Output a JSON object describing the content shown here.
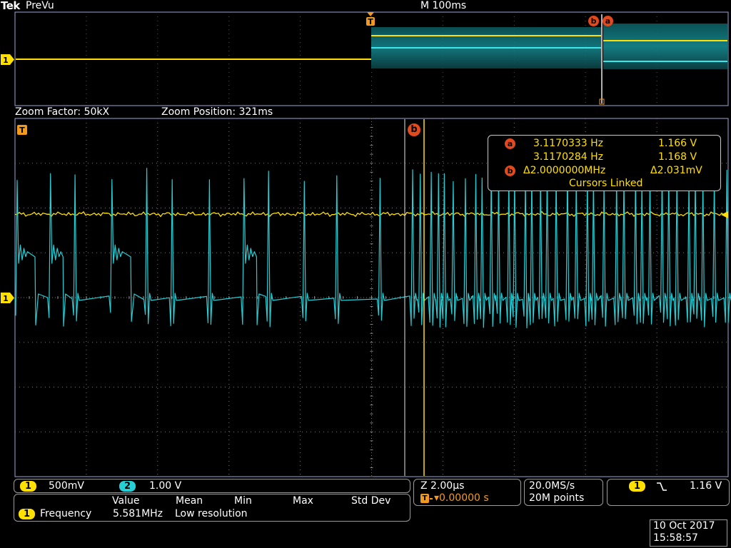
{
  "header": {
    "brand": "Tek",
    "mode": "PreVu",
    "timebase": "M 100ms"
  },
  "zoom": {
    "factor": "Zoom Factor: 50kX",
    "position": "Zoom Position: 321ms"
  },
  "markers": {
    "trigger": "T",
    "cursor_a": "a",
    "cursor_b": "b",
    "ch1": "1"
  },
  "cursor_readout": {
    "a_freq": "3.1170333 Hz",
    "a_volt": "1.166 V",
    "b_freq": "3.1170284 Hz",
    "b_volt": "1.168 V",
    "delta_freq": "Δ2.0000000MHz",
    "delta_volt": "Δ2.031mV",
    "linked": "Cursors Linked"
  },
  "channels": [
    {
      "id": "1",
      "scale": "500mV",
      "color": "#ffe000"
    },
    {
      "id": "2",
      "scale": "1.00 V",
      "color": "#25cfd6"
    }
  ],
  "measurements": {
    "headers": [
      "Value",
      "Mean",
      "Min",
      "Max",
      "Std Dev"
    ],
    "rows": [
      {
        "channel": "1",
        "name": "Frequency",
        "value": "5.581MHz",
        "note": "Low resolution"
      }
    ]
  },
  "horizontal": {
    "zoom_scale": "Z 2.00μs",
    "trigger_pos": "▾0.00000 s"
  },
  "acquisition": {
    "rate": "20.0MS/s",
    "points": "20M points"
  },
  "trigger": {
    "channel": "1",
    "slope_icon": "falling-edge-icon",
    "level": "1.16 V"
  },
  "datetime": {
    "date": "10 Oct  2017",
    "time": "15:58:57"
  },
  "colors": {
    "ch1": "#ffe000",
    "ch2": "#25cfd6",
    "cursor_marker": "#e2491d",
    "trigger": "#f29a1e",
    "grid": "#8a8a8a",
    "border": "#9aa6d8"
  },
  "chart_data": {
    "type": "line",
    "x_unit": "μs",
    "xlim": [
      -10,
      10
    ],
    "ylim": [
      -4,
      4
    ],
    "grid": true,
    "series": [
      {
        "name": "1",
        "color": "#ffe000",
        "x": [
          -10,
          -8,
          -6,
          -4,
          -2,
          0,
          2,
          4,
          6,
          8,
          10
        ],
        "y": [
          1.16,
          1.15,
          1.17,
          1.16,
          1.15,
          1.17,
          1.16,
          1.15,
          1.16,
          1.17,
          1.16
        ]
      },
      {
        "name": "2",
        "color": "#25cfd6",
        "x": [
          -10,
          -9,
          -8,
          -7,
          -6,
          -5,
          -4,
          -3,
          -2,
          -1,
          0,
          1,
          2,
          3,
          4,
          5,
          6,
          7,
          8,
          9,
          10
        ],
        "y": [
          0.0,
          2.2,
          -0.2,
          2.3,
          0.0,
          2.4,
          -0.3,
          2.2,
          0.0,
          2.5,
          -0.2,
          2.4,
          0.0,
          2.5,
          -0.3,
          2.2,
          0.0,
          2.4,
          -0.2,
          2.3,
          0.0
        ]
      }
    ]
  }
}
